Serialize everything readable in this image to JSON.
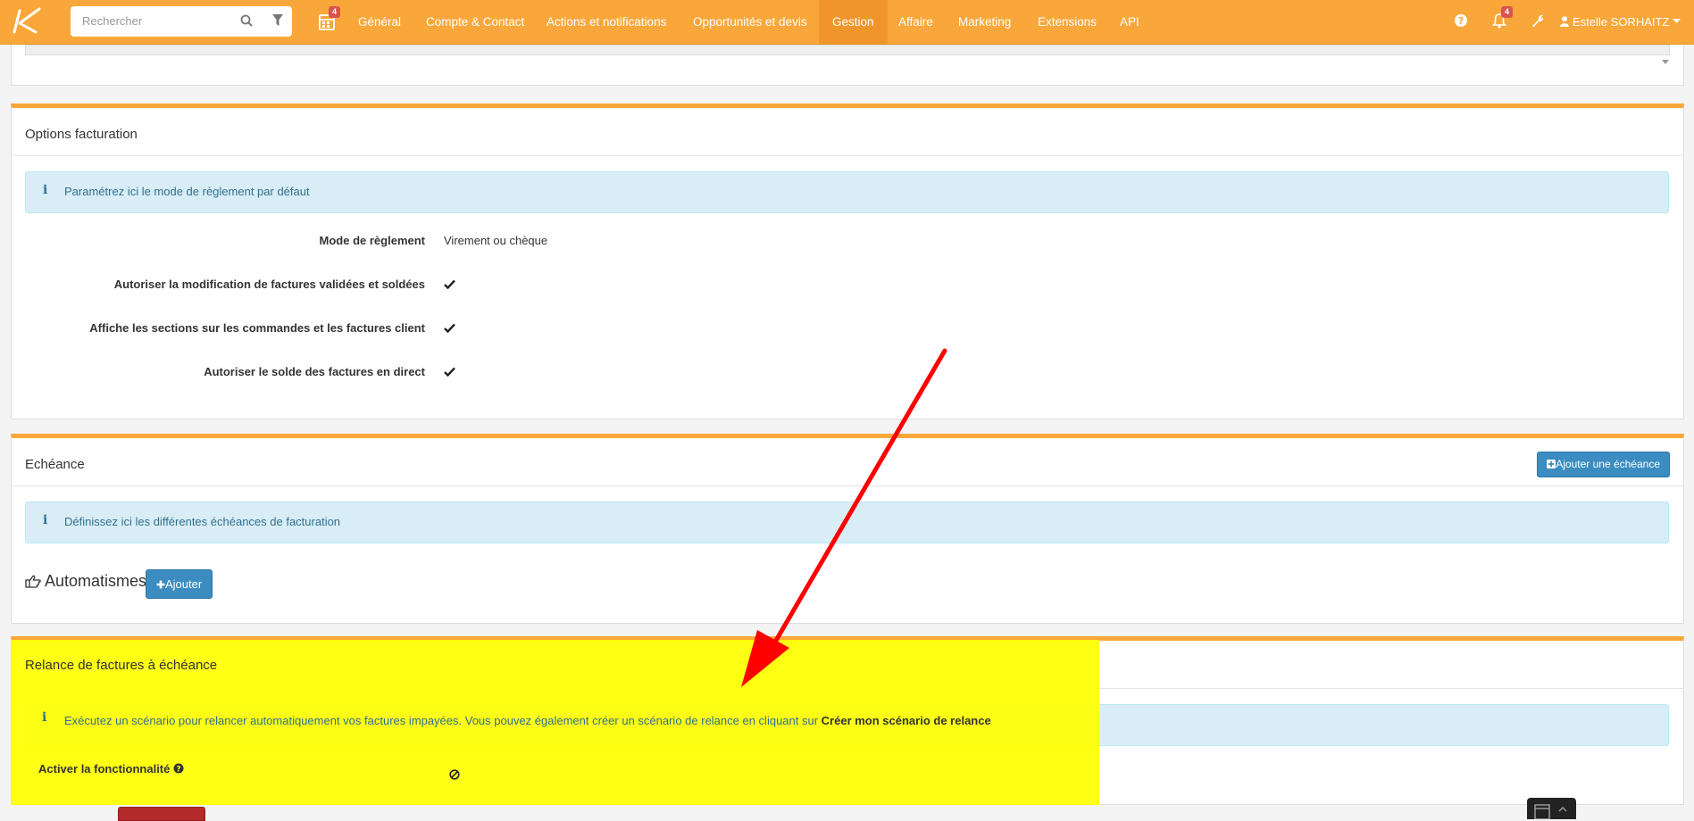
{
  "nav": {
    "search_placeholder": "Rechercher",
    "calendar_badge": "4",
    "items": [
      {
        "label": "Général"
      },
      {
        "label": "Compte & Contact"
      },
      {
        "label": "Actions et notifications"
      },
      {
        "label": "Opportunités et devis"
      },
      {
        "label": "Gestion"
      },
      {
        "label": "Affaire"
      },
      {
        "label": "Marketing"
      },
      {
        "label": "Extensions"
      },
      {
        "label": "API"
      }
    ],
    "notifications_badge": "4",
    "user_name": "Estelle SORHAITZ"
  },
  "options_facturation": {
    "title": "Options facturation",
    "info": "Paramétrez ici le mode de règlement par défaut",
    "rows": [
      {
        "label": "Mode de règlement",
        "value": "Virement ou chèque"
      },
      {
        "label": "Autoriser la modification de factures validées et soldées"
      },
      {
        "label": "Affiche les sections sur les commandes et les factures client"
      },
      {
        "label": "Autoriser le solde des factures en direct"
      }
    ]
  },
  "echeance": {
    "title": "Echéance",
    "add_button": "Ajouter une échéance",
    "info": "Définissez ici les différentes échéances de facturation",
    "automatismes_label": "Automatismes",
    "add_automatisme_button": "Ajouter"
  },
  "relance": {
    "title": "Relance de factures à échéance",
    "info_text": "Exécutez un scénario pour relancer automatiquement vos factures impayées. Vous pouvez également créer un scénario de relance en cliquant sur",
    "info_link": "Créer mon scénario de relance",
    "activate_label": "Activer la fonctionnalité"
  },
  "colors": {
    "accent": "#f9a73a",
    "info_bg": "#d9edf7",
    "button_blue": "#3a8cc1",
    "highlight": "#ffff00",
    "arrow": "#ff0000"
  }
}
